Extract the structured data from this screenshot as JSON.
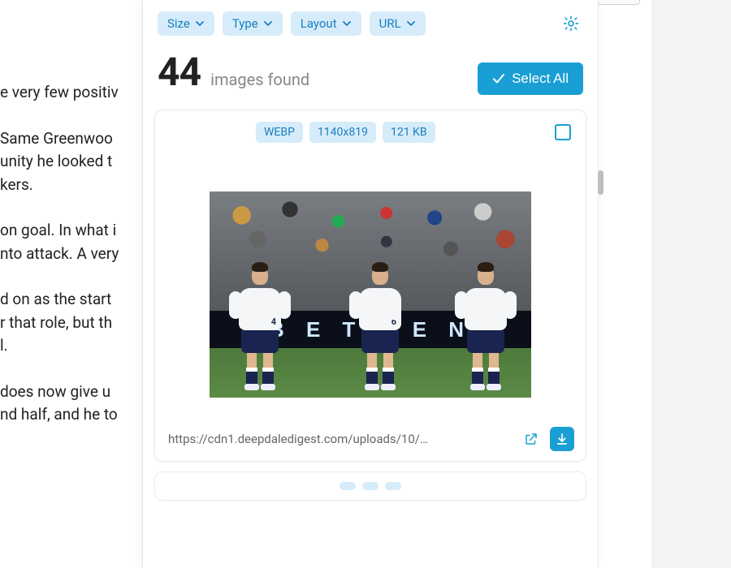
{
  "article": {
    "p1": "e very few positiv",
    "p2a": "Same Greenwoo",
    "p2b": "unity he looked t",
    "p2c": "kers.",
    "p3a": "on goal. In what i",
    "p3b": "nto attack. A very",
    "p4a": "d on as the start",
    "p4b": "r that role, but th",
    "p4c": "l.",
    "p5a": " does now give u",
    "p5b": "nd half, and he to"
  },
  "filters": {
    "size": "Size",
    "type": "Type",
    "layout": "Layout",
    "url": "URL"
  },
  "count": {
    "value": "44",
    "label": "images found"
  },
  "select_all_label": "Select All",
  "card1": {
    "format": "WEBP",
    "dimensions": "1140x819",
    "filesize": "121 KB",
    "adboard_text": "B E T T E   N",
    "player_numbers": {
      "p1": "4",
      "p2": "6",
      "p3": ""
    },
    "url": "https://cdn1.deepdaledigest.com/uploads/10/…"
  },
  "card2": {
    "format_partial": "",
    "dims_partial": "",
    "size_partial": ""
  }
}
